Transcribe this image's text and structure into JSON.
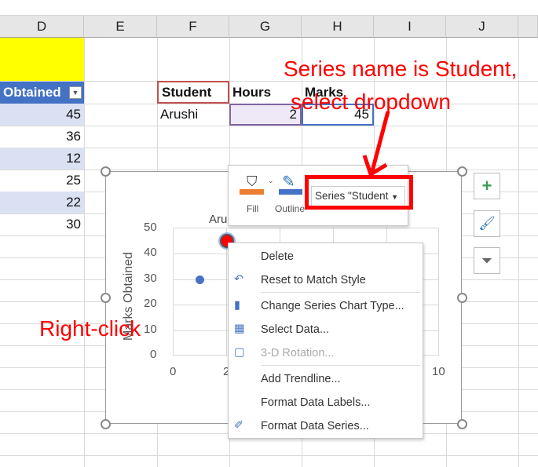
{
  "columns": [
    "D",
    "E",
    "F",
    "G",
    "H",
    "I",
    "J"
  ],
  "table": {
    "header": "Obtained",
    "values": [
      "45",
      "36",
      "12",
      "25",
      "22",
      "30"
    ]
  },
  "mini_table": {
    "headers": [
      "Student",
      "Hours",
      "Marks"
    ],
    "row": [
      "Arushi",
      "2",
      "45"
    ]
  },
  "chart": {
    "title": "Aru",
    "ylabel": "Marks Obtained",
    "yticks": [
      "0",
      "10",
      "20",
      "30",
      "40",
      "50"
    ],
    "xticks": [
      "0",
      "2",
      "10"
    ],
    "xlim": [
      0,
      10
    ],
    "ylim": [
      0,
      50
    ],
    "points": [
      {
        "x": 1,
        "y": 30,
        "color": "#4472c4"
      },
      {
        "x": 2,
        "y": 45,
        "color": "#ff0000",
        "selected": true
      }
    ]
  },
  "toolbar": {
    "fill_label": "Fill",
    "outline_label": "Outline",
    "series_dropdown": "Series \"Student",
    "fill_color": "#ed7d31",
    "outline_color": "#4472c4"
  },
  "menu": [
    {
      "label": "Delete",
      "icon": ""
    },
    {
      "label": "Reset to Match Style",
      "icon": "reset-style-icon"
    },
    {
      "label": "Change Series Chart Type...",
      "icon": "chart-type-icon"
    },
    {
      "label": "Select Data...",
      "icon": "select-data-icon"
    },
    {
      "label": "3-D Rotation...",
      "icon": "3d-rotation-icon",
      "disabled": true
    },
    {
      "label": "Add Trendline...",
      "icon": ""
    },
    {
      "label": "Format Data Labels...",
      "icon": ""
    },
    {
      "label": "Format Data Series...",
      "icon": "format-series-icon"
    }
  ],
  "side_buttons": [
    "plus-icon",
    "brush-icon",
    "filter-icon"
  ],
  "annotations": {
    "top": "Series name is Student,",
    "top2": "select dropdown",
    "left": "Right-click",
    "color": "#ff0000"
  }
}
